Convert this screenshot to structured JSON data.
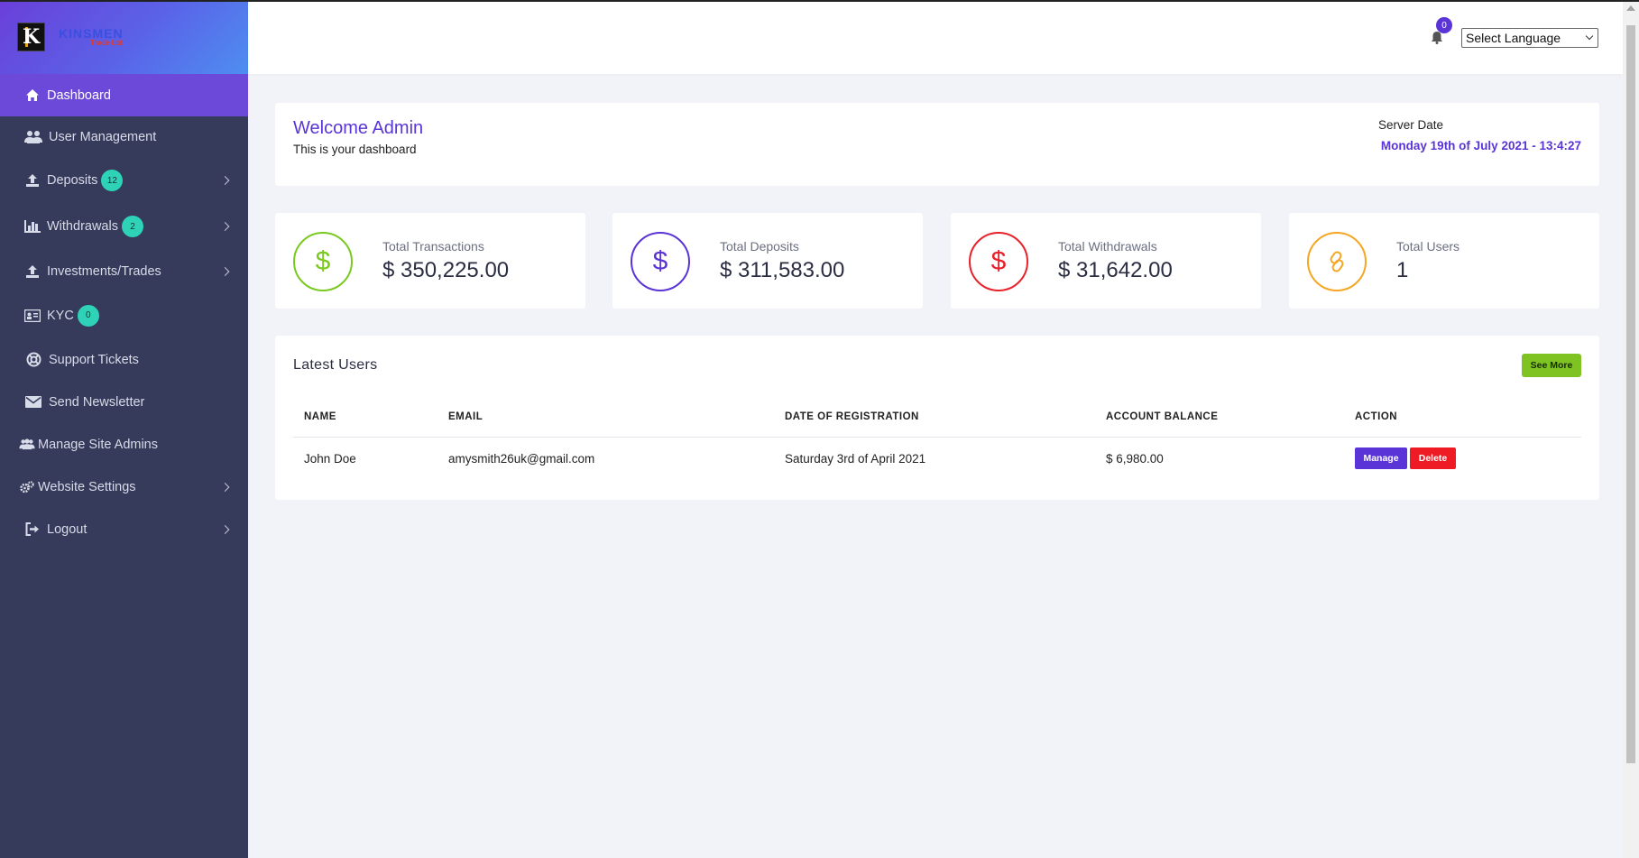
{
  "brand": {
    "logo_letter": "K",
    "name": "KINSMEN",
    "sub": "Trade Ltd"
  },
  "sidebar": {
    "items": [
      {
        "label": "Dashboard",
        "icon": "home-icon",
        "active": true
      },
      {
        "label": "User Management",
        "icon": "users-icon"
      },
      {
        "label": "Deposits",
        "icon": "upload-icon",
        "badge": "12",
        "has_children": true
      },
      {
        "label": "Withdrawals",
        "icon": "bar-chart-icon",
        "badge": "2",
        "has_children": true
      },
      {
        "label": "Investments/Trades",
        "icon": "upload-icon",
        "has_children": true
      },
      {
        "label": "KYC",
        "icon": "id-card-icon",
        "badge": "0"
      },
      {
        "label": "Support Tickets",
        "icon": "life-ring-icon"
      },
      {
        "label": "Send Newsletter",
        "icon": "envelope-icon"
      },
      {
        "label": "Manage Site Admins",
        "icon": "users-icon"
      },
      {
        "label": "Website Settings",
        "icon": "gears-icon",
        "has_children": true
      },
      {
        "label": "Logout",
        "icon": "sign-out-icon",
        "has_children": true
      }
    ]
  },
  "header": {
    "notification_count": "0",
    "language_select": "Select Language"
  },
  "welcome": {
    "title": "Welcome Admin",
    "subtitle": "This is your dashboard",
    "server_label": "Server Date",
    "server_date": "Monday 19th of July 2021 - 13:4:27"
  },
  "stats": [
    {
      "label": "Total Transactions",
      "value": "$ 350,225.00",
      "color": "#7ac91f",
      "icon": "dollar-icon"
    },
    {
      "label": "Total Deposits",
      "value": "$ 311,583.00",
      "color": "#5a34d6",
      "icon": "dollar-icon"
    },
    {
      "label": "Total Withdrawals",
      "value": "$ 31,642.00",
      "color": "#e8212a",
      "icon": "dollar-icon"
    },
    {
      "label": "Total Users",
      "value": "1",
      "color": "#f5a623",
      "icon": "link-icon"
    }
  ],
  "latest_users": {
    "title": "Latest Users",
    "see_more": "See More",
    "columns": [
      "NAME",
      "EMAIL",
      "DATE OF REGISTRATION",
      "ACCOUNT BALANCE",
      "ACTION"
    ],
    "rows": [
      {
        "name": "John Doe",
        "email": "amysmith26uk@gmail.com",
        "date": "Saturday 3rd of April 2021",
        "balance": "$ 6,980.00",
        "manage": "Manage",
        "delete": "Delete"
      }
    ]
  },
  "colors": {
    "sidebar_bg": "#363a5b",
    "accent": "#5a34d6",
    "active_item": "#6c49d8",
    "badge": "#2ed3b7",
    "success": "#7ec322",
    "danger": "#ee1b24"
  }
}
